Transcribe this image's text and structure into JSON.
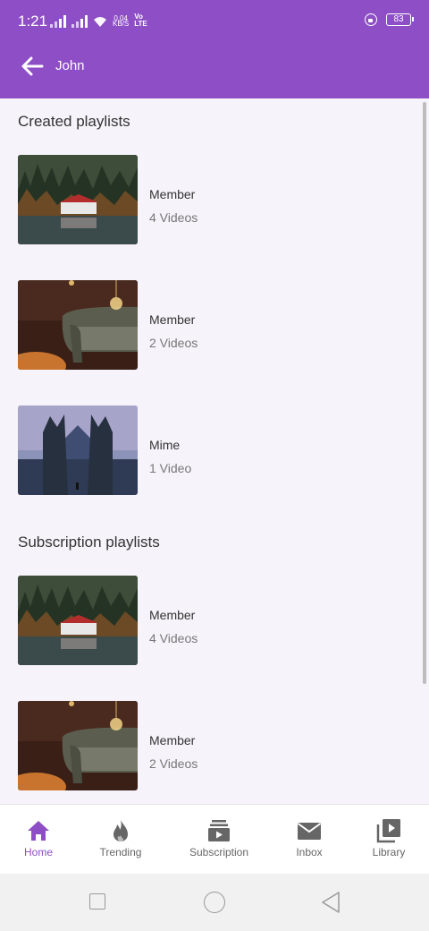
{
  "status_bar": {
    "time": "1:21",
    "net_speed_value": "0.04",
    "net_speed_unit": "KB/S",
    "volte_line1": "Vo",
    "volte_line2": "LTE",
    "battery": "83"
  },
  "header": {
    "back_icon": "arrow-left-icon",
    "title": "John"
  },
  "sections": [
    {
      "title": "Created playlists",
      "playlists": [
        {
          "name": "Member",
          "count": "4 Videos",
          "thumbnail": "lake-house"
        },
        {
          "name": "Member",
          "count": "2 Videos",
          "thumbnail": "sofa-lamp"
        },
        {
          "name": "Mime",
          "count": "1 Video",
          "thumbnail": "temple-gate"
        }
      ]
    },
    {
      "title": "Subscription playlists",
      "playlists": [
        {
          "name": "Member",
          "count": "4 Videos",
          "thumbnail": "lake-house"
        },
        {
          "name": "Member",
          "count": "2 Videos",
          "thumbnail": "sofa-lamp"
        }
      ]
    }
  ],
  "bottom_nav": [
    {
      "label": "Home",
      "icon": "home-icon",
      "active": true
    },
    {
      "label": "Trending",
      "icon": "flame-icon",
      "active": false
    },
    {
      "label": "Subscription",
      "icon": "subscription-icon",
      "active": false
    },
    {
      "label": "Inbox",
      "icon": "mail-icon",
      "active": false
    },
    {
      "label": "Library",
      "icon": "video-library-icon",
      "active": false
    }
  ],
  "colors": {
    "primary": "#8e4ec6",
    "background": "#f6f3fa",
    "text": "#333333",
    "muted_text": "#777777"
  }
}
